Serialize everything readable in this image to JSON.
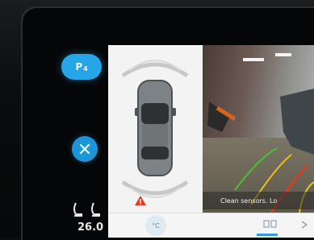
{
  "left": {
    "park_button_label": "P",
    "park_button_sub": "4",
    "temperature": "26.0"
  },
  "camera": {
    "warning_text": "Clean sensors. Lo"
  },
  "bottom_bar": {
    "item_climate_label": "°C",
    "item_view_label": "",
    "item_more_label": ""
  },
  "colors": {
    "accent": "#25a6e8",
    "sensor_arc": "#c8c8c8",
    "guide_red": "#e03a22",
    "guide_yellow": "#e8c21d",
    "guide_green": "#4bbf3a"
  }
}
